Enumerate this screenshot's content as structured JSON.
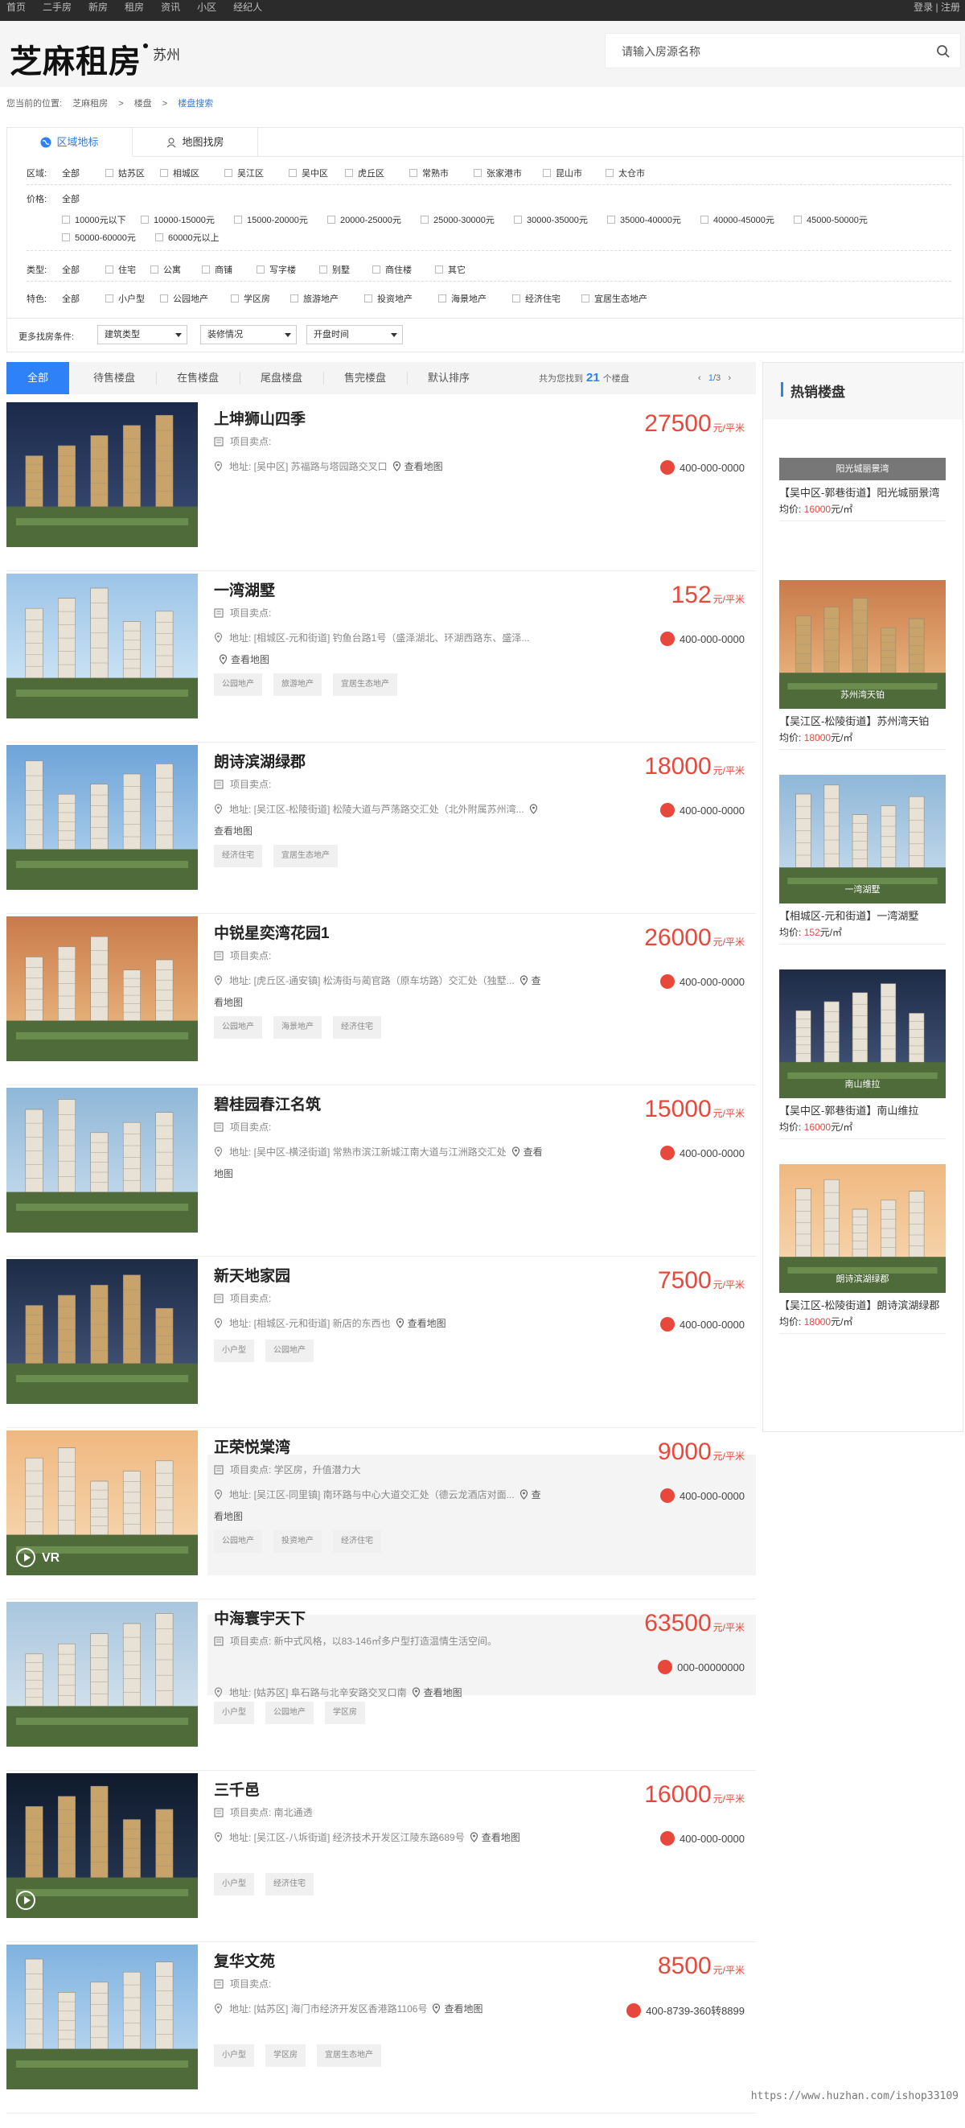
{
  "topnav": {
    "links": [
      "首页",
      "二手房",
      "新房",
      "租房",
      "资讯",
      "小区",
      "经纪人"
    ],
    "login": "登录",
    "divider": "|",
    "register": "注册"
  },
  "header": {
    "logo": "芝麻租房",
    "city": "苏州",
    "search_placeholder": "请输入房源名称",
    "search_icon": "search-icon"
  },
  "breadcrumb": {
    "prefix": "您当前的位置:",
    "items": [
      "芝麻租房",
      "楼盘"
    ],
    "current": "楼盘搜索",
    "sep": ">"
  },
  "filter": {
    "tabs": [
      "区域地标",
      "地图找房"
    ],
    "area": {
      "label": "区域:",
      "options": [
        "全部",
        "姑苏区",
        "相城区",
        "吴江区",
        "吴中区",
        "虎丘区",
        "常熟市",
        "张家港市",
        "昆山市",
        "太仓市"
      ]
    },
    "price": {
      "label": "价格:",
      "all": "全部",
      "options": [
        "10000元以下",
        "10000-15000元",
        "15000-20000元",
        "20000-25000元",
        "25000-30000元",
        "30000-35000元",
        "35000-40000元",
        "40000-45000元",
        "45000-50000元",
        "50000-60000元",
        "60000元以上"
      ]
    },
    "type": {
      "label": "类型:",
      "options": [
        "全部",
        "住宅",
        "公寓",
        "商铺",
        "写字楼",
        "别墅",
        "商住楼",
        "其它"
      ]
    },
    "feature": {
      "label": "特色:",
      "options": [
        "全部",
        "小户型",
        "公园地产",
        "学区房",
        "旅游地产",
        "投资地产",
        "海景地产",
        "经济住宅",
        "宜居生态地产"
      ]
    },
    "more": {
      "label": "更多找房条件:",
      "selects": [
        "建筑类型",
        "装修情况",
        "开盘时间"
      ]
    }
  },
  "status_tabs": {
    "items": [
      "全部",
      "待售楼盘",
      "在售楼盘",
      "尾盘楼盘",
      "售完楼盘",
      "默认排序"
    ],
    "found_prefix": "共为您找到",
    "found_count": "21",
    "found_suffix": "个楼盘",
    "pager": {
      "prev": "‹",
      "current": "1",
      "slash": "/",
      "total": "3",
      "next": "›"
    }
  },
  "listings": [
    {
      "title": "上坤狮山四季",
      "price": "27500",
      "unit": "元/平米",
      "selling": "项目卖点:",
      "address": "地址: [吴中区] 苏福路与塔园路交叉口",
      "map": "查看地图",
      "phone": "400-000-0000",
      "tags": []
    },
    {
      "title": "一湾湖墅",
      "price": "152",
      "unit": "元/平米",
      "selling": "项目卖点:",
      "address": "地址: [相城区-元和街道] 钓鱼台路1号（盛泽湖北、环湖西路东、盛泽...",
      "map": "查看地图",
      "phone": "400-000-0000",
      "tags": [
        "公园地产",
        "旅游地产",
        "宜居生态地产"
      ]
    },
    {
      "title": "朗诗滨湖绿郡",
      "price": "18000",
      "unit": "元/平米",
      "selling": "项目卖点:",
      "address": "地址: [吴江区-松陵街道] 松陵大道与芦荡路交汇处（北外附属苏州湾...",
      "map": "查看地图",
      "phone": "400-000-0000",
      "tags": [
        "经济住宅",
        "宜居生态地产"
      ]
    },
    {
      "title": "中锐星奕湾花园1",
      "price": "26000",
      "unit": "元/平米",
      "selling": "项目卖点:",
      "address": "地址: [虎丘区-通安镇] 松涛街与蔺官路（原车坊路）交汇处（独墅...",
      "map": "查看地图",
      "phone": "400-000-0000",
      "tags": [
        "公园地产",
        "海景地产",
        "经济住宅"
      ]
    },
    {
      "title": "碧桂园春江名筑",
      "price": "15000",
      "unit": "元/平米",
      "selling": "项目卖点:",
      "address": "地址: [吴中区-横泾街道] 常熟市滨江新城江南大道与江洲路交汇处",
      "map": "查看地图",
      "phone": "400-000-0000",
      "tags": []
    },
    {
      "title": "新天地家园",
      "price": "7500",
      "unit": "元/平米",
      "selling": "项目卖点:",
      "address": "地址: [相城区-元和街道] 新店的东西也",
      "map": "查看地图",
      "phone": "400-000-0000",
      "tags": [
        "小户型",
        "公园地产"
      ]
    },
    {
      "title": "正荣悦棠湾",
      "price": "9000",
      "unit": "元/平米",
      "selling": "项目卖点: 学区房，升值潜力大",
      "address": "地址: [吴江区-同里镇] 南环路与中心大道交汇处（德云龙酒店对面...",
      "map": "查看地图",
      "phone": "400-000-0000",
      "tags": [
        "公园地产",
        "投资地产",
        "经济住宅"
      ]
    },
    {
      "title": "中海寰宇天下",
      "price": "63500",
      "unit": "元/平米",
      "selling": "项目卖点: 新中式风格，以83-146㎡多户型打造温情生活空间。",
      "address": "地址: [姑苏区] 阜石路与北辛安路交叉口南",
      "map": "查看地图",
      "phone": "000-00000000",
      "tags": [
        "小户型",
        "公园地产",
        "学区房"
      ]
    },
    {
      "title": "三千邑",
      "price": "16000",
      "unit": "元/平米",
      "selling": "项目卖点: 南北通透",
      "address": "地址: [吴江区-八坼街道] 经济技术开发区江陵东路689号",
      "map": "查看地图",
      "phone": "400-000-0000",
      "tags": [
        "小户型",
        "经济住宅"
      ]
    },
    {
      "title": "复华文苑",
      "price": "8500",
      "unit": "元/平米",
      "selling": "项目卖点:",
      "address": "地址: [姑苏区] 海门市经济开发区香港路1106号",
      "map": "查看地图",
      "phone": "400-8739-360转8899",
      "tags": [
        "小户型",
        "学区房",
        "宜居生态地产"
      ]
    }
  ],
  "hot": {
    "title": "热销楼盘",
    "items": [
      {
        "caption": "阳光城丽景湾",
        "name": "【吴中区-郭巷街道】阳光城丽景湾",
        "price_label": "均价:",
        "price": "16000",
        "unit": "元/㎡"
      },
      {
        "caption": "苏州湾天铂",
        "name": "【吴江区-松陵街道】苏州湾天铂",
        "price_label": "均价:",
        "price": "18000",
        "unit": "元/㎡"
      },
      {
        "caption": "一湾湖墅",
        "name": "【相城区-元和街道】一湾湖墅",
        "price_label": "均价:",
        "price": "152",
        "unit": "元/㎡"
      },
      {
        "caption": "南山维拉",
        "name": "【吴中区-郭巷街道】南山维拉",
        "price_label": "均价:",
        "price": "16000",
        "unit": "元/㎡"
      },
      {
        "caption": "朗诗滨湖绿郡",
        "name": "【吴江区-松陵街道】朗诗滨湖绿郡",
        "price_label": "均价:",
        "price": "18000",
        "unit": "元/㎡"
      }
    ]
  },
  "watermark": "https://www.huzhan.com/ishop33109",
  "colors": {
    "accent": "#2f81f7",
    "price": "#e8483b",
    "topbar": "#2b2b2b"
  }
}
